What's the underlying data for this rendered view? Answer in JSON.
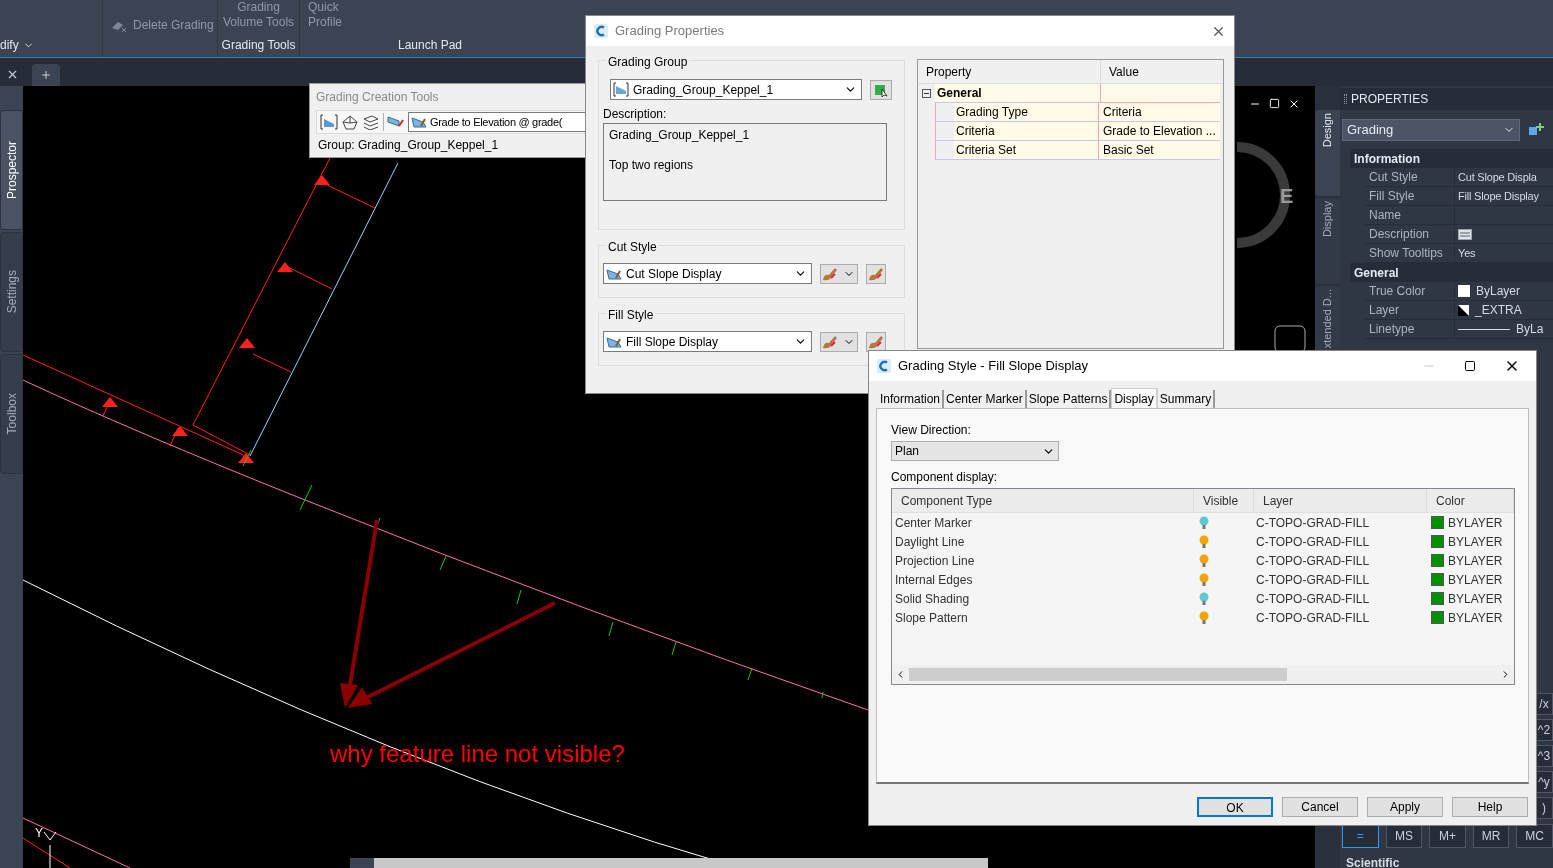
{
  "ribbon": {
    "small_buttons": [
      {
        "label": "Delete Grading"
      }
    ],
    "large_buttons": [
      {
        "lines": [
          "Grading",
          "Volume Tools"
        ]
      },
      {
        "lines": [
          "Quick",
          "Profile"
        ]
      }
    ],
    "panels": [
      {
        "label": "dify",
        "menu": true
      },
      {
        "label": "Grading Tools",
        "menu": false
      },
      {
        "label": "Launch Pad",
        "menu": false
      }
    ]
  },
  "palette_tabs": [
    {
      "label": "Prospector",
      "selected": true
    },
    {
      "label": "Settings",
      "selected": false
    },
    {
      "label": "Toolbox",
      "selected": false
    }
  ],
  "canvas": {
    "annotation": "why feature line not visible?",
    "ucs_axis": "Y",
    "viewcube_direction": "E"
  },
  "creation_tools": {
    "title": "Grading Creation Tools",
    "criteria": "Grade to Elevation @ grade(",
    "group": "Group: Grading_Group_Keppel_1"
  },
  "grading_properties": {
    "title": "Grading Properties",
    "group_section": {
      "label": "Grading Group",
      "value": "Grading_Group_Keppel_1",
      "description_label": "Description:",
      "description": [
        "Grading_Group_Keppel_1",
        "Top two regions"
      ]
    },
    "style_sections": [
      {
        "label": "Cut Style",
        "value": "Cut Slope Display"
      },
      {
        "label": "Fill Style",
        "value": "Fill Slope Display"
      }
    ],
    "grid": {
      "columns": [
        "Property",
        "Value"
      ],
      "groups": [
        {
          "name": "General",
          "expanded": true,
          "rows": [
            {
              "property": "Grading Type",
              "value": "Criteria"
            },
            {
              "property": "Criteria",
              "value": "Grade to Elevation ..."
            },
            {
              "property": "Criteria Set",
              "value": "Basic Set"
            }
          ]
        }
      ]
    }
  },
  "properties_panel": {
    "title": "PROPERTIES",
    "object": "Grading",
    "side_tabs": [
      {
        "label": "Design",
        "selected": true
      },
      {
        "label": "Display",
        "selected": false
      },
      {
        "label": "xtended D...",
        "selected": false
      }
    ],
    "sections": [
      {
        "name": "Information",
        "rows": [
          {
            "label": "Cut Style",
            "kind": "text",
            "value": "Cut Slope Displa"
          },
          {
            "label": "Fill Style",
            "kind": "text",
            "value": "Fill Slope Display"
          },
          {
            "label": "Name",
            "kind": "empty"
          },
          {
            "label": "Description",
            "kind": "editor"
          },
          {
            "label": "Show Tooltips",
            "kind": "text",
            "value": "Yes"
          }
        ]
      },
      {
        "name": "General",
        "rows": [
          {
            "label": "True Color",
            "kind": "swatch",
            "value": "ByLayer"
          },
          {
            "label": "Layer",
            "kind": "layer",
            "value": "_EXTRA"
          },
          {
            "label": "Linetype",
            "kind": "line",
            "value": "ByLa"
          }
        ]
      }
    ],
    "calculator": {
      "side_keys": [
        "/x",
        "^2",
        "^3",
        "^y",
        ")"
      ],
      "keys": [
        {
          "label": "=",
          "selected": true
        },
        {
          "label": "MS",
          "selected": false
        },
        {
          "label": "M+",
          "selected": false
        },
        {
          "label": "MR",
          "selected": false
        },
        {
          "label": "MC",
          "selected": false
        }
      ],
      "heading": "Scientific"
    }
  },
  "grading_style": {
    "title": "Grading Style - Fill Slope Display",
    "tabs": [
      {
        "label": "Information",
        "selected": false
      },
      {
        "label": "Center Marker",
        "selected": false
      },
      {
        "label": "Slope Patterns",
        "selected": false
      },
      {
        "label": "Display",
        "selected": true
      },
      {
        "label": "Summary",
        "selected": false
      }
    ],
    "view_direction": {
      "label": "View Direction:",
      "value": "Plan"
    },
    "component_label": "Component display:",
    "table": {
      "columns": [
        "Component Type",
        "Visible",
        "Layer",
        "Color"
      ],
      "rows": [
        {
          "type": "Center Marker",
          "visible": false,
          "layer": "C-TOPO-GRAD-FILL",
          "color_name": "BYLAYER"
        },
        {
          "type": "Daylight Line",
          "visible": true,
          "layer": "C-TOPO-GRAD-FILL",
          "color_name": "BYLAYER"
        },
        {
          "type": "Projection Line",
          "visible": true,
          "layer": "C-TOPO-GRAD-FILL",
          "color_name": "BYLAYER"
        },
        {
          "type": "Internal Edges",
          "visible": true,
          "layer": "C-TOPO-GRAD-FILL",
          "color_name": "BYLAYER"
        },
        {
          "type": "Solid Shading",
          "visible": false,
          "layer": "C-TOPO-GRAD-FILL",
          "color_name": "BYLAYER"
        },
        {
          "type": "Slope Pattern",
          "visible": true,
          "layer": "C-TOPO-GRAD-FILL",
          "color_name": "BYLAYER"
        }
      ]
    },
    "buttons": [
      {
        "label": "OK",
        "default": true
      },
      {
        "label": "Cancel",
        "default": false
      },
      {
        "label": "Apply",
        "default": false
      },
      {
        "label": "Help",
        "default": false
      }
    ]
  }
}
